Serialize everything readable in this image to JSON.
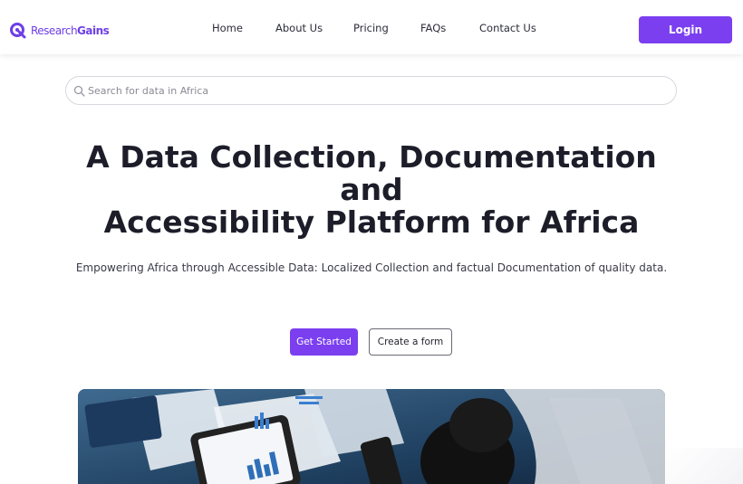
{
  "brand": {
    "name_part1": "Research",
    "name_part2": "Gains",
    "accent_color": "#7b3ff0"
  },
  "nav": {
    "links": [
      {
        "label": "Home"
      },
      {
        "label": "About Us"
      },
      {
        "label": "Pricing"
      },
      {
        "label": "FAQs"
      },
      {
        "label": "Contact Us"
      }
    ],
    "login_label": "Login"
  },
  "search": {
    "placeholder": "Search for data in Africa",
    "value": "",
    "icon": "search-icon"
  },
  "hero": {
    "title_line1": "A Data Collection, Documentation",
    "title_line2": "and",
    "title_line3": "Accessibility Platform for Africa",
    "subtitle": "Empowering Africa through Accessible Data: Localized Collection and factual Documentation of quality data.",
    "primary_cta": "Get Started",
    "secondary_cta": "Create a form"
  }
}
